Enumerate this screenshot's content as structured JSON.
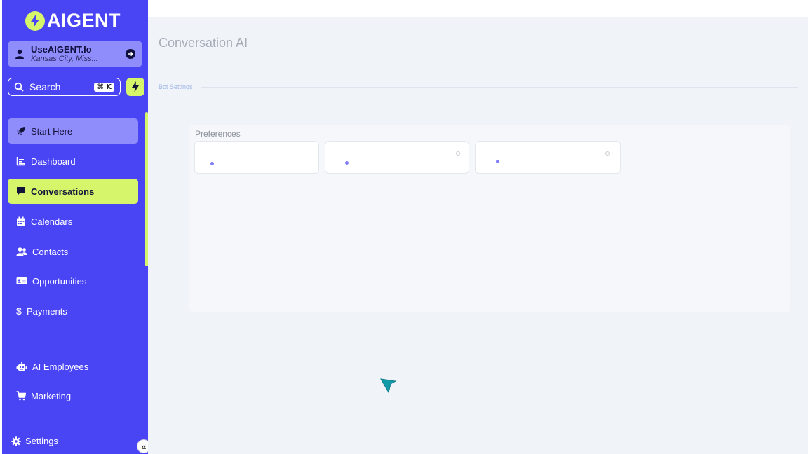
{
  "brand": {
    "name": "AIGENT",
    "accent": "#d6f56a",
    "sidebar_color": "#4a45f4"
  },
  "account": {
    "name": "UseAIGENT.Io",
    "location": "Kansas City, Miss..."
  },
  "search": {
    "label": "Search",
    "shortcut": "⌘ K"
  },
  "nav": {
    "items": [
      {
        "label": "Start Here",
        "icon": "rocket-icon"
      },
      {
        "label": "Dashboard",
        "icon": "chart-icon"
      },
      {
        "label": "Conversations",
        "icon": "chat-icon"
      },
      {
        "label": "Calendars",
        "icon": "calendar-icon"
      },
      {
        "label": "Contacts",
        "icon": "contacts-icon"
      },
      {
        "label": "Opportunities",
        "icon": "id-card-icon"
      },
      {
        "label": "Payments",
        "icon": "dollar-icon"
      }
    ],
    "secondary": [
      {
        "label": "AI Employees",
        "icon": "robot-icon"
      },
      {
        "label": "Marketing",
        "icon": "cart-icon"
      }
    ],
    "settings_label": "Settings",
    "collapse_label": "«"
  },
  "main": {
    "title": "Conversation AI",
    "tab": "Bot Settings",
    "panel_title": "Preferences"
  }
}
